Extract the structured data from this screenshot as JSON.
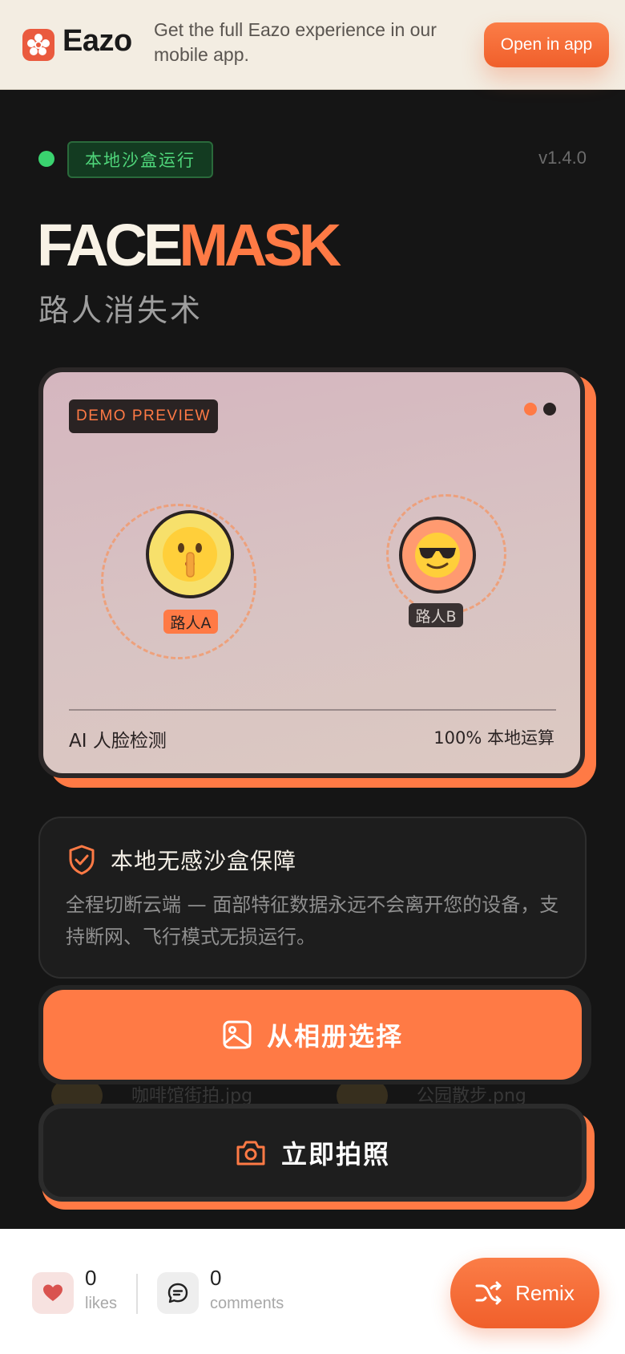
{
  "banner": {
    "brand": "Eazo",
    "message": "Get the full Eazo experience in our mobile app.",
    "open_label": "Open in app"
  },
  "status": {
    "sandbox_label": "本地沙盒运行",
    "version": "v1.4.0"
  },
  "hero": {
    "title_part1": "FACE",
    "title_part2": "MASK",
    "subtitle": "路人消失术"
  },
  "demo": {
    "badge": "DEMO PREVIEW",
    "person_a_label": "路人A",
    "person_a_emoji": "🤫",
    "person_b_label": "路人B",
    "person_b_emoji": "😎",
    "footer_left": "AI 人脸检测",
    "footer_right": "100% 本地运算"
  },
  "security": {
    "title": "本地无感沙盒保障",
    "body": "全程切断云端 — 面部特征数据永远不会离开您的设备，支持断网、飞行模式无损运行。"
  },
  "ghost_files": [
    "咖啡馆街拍.jpg",
    "公园散步.png"
  ],
  "actions": {
    "album_label": "从相册选择",
    "camera_label": "立即拍照"
  },
  "social": {
    "likes_count": "0",
    "likes_label": "likes",
    "comments_count": "0",
    "comments_label": "comments",
    "remix_label": "Remix"
  },
  "colors": {
    "accent": "#ff7a45",
    "background": "#151515",
    "banner_bg": "#f3ede2",
    "success": "#3ad36f"
  },
  "icons": {
    "logo": "eazo-logo-icon",
    "shield": "shield-check-icon",
    "album": "image-icon",
    "camera": "camera-icon",
    "like": "heart-icon",
    "comment": "comment-icon",
    "remix": "shuffle-icon"
  }
}
